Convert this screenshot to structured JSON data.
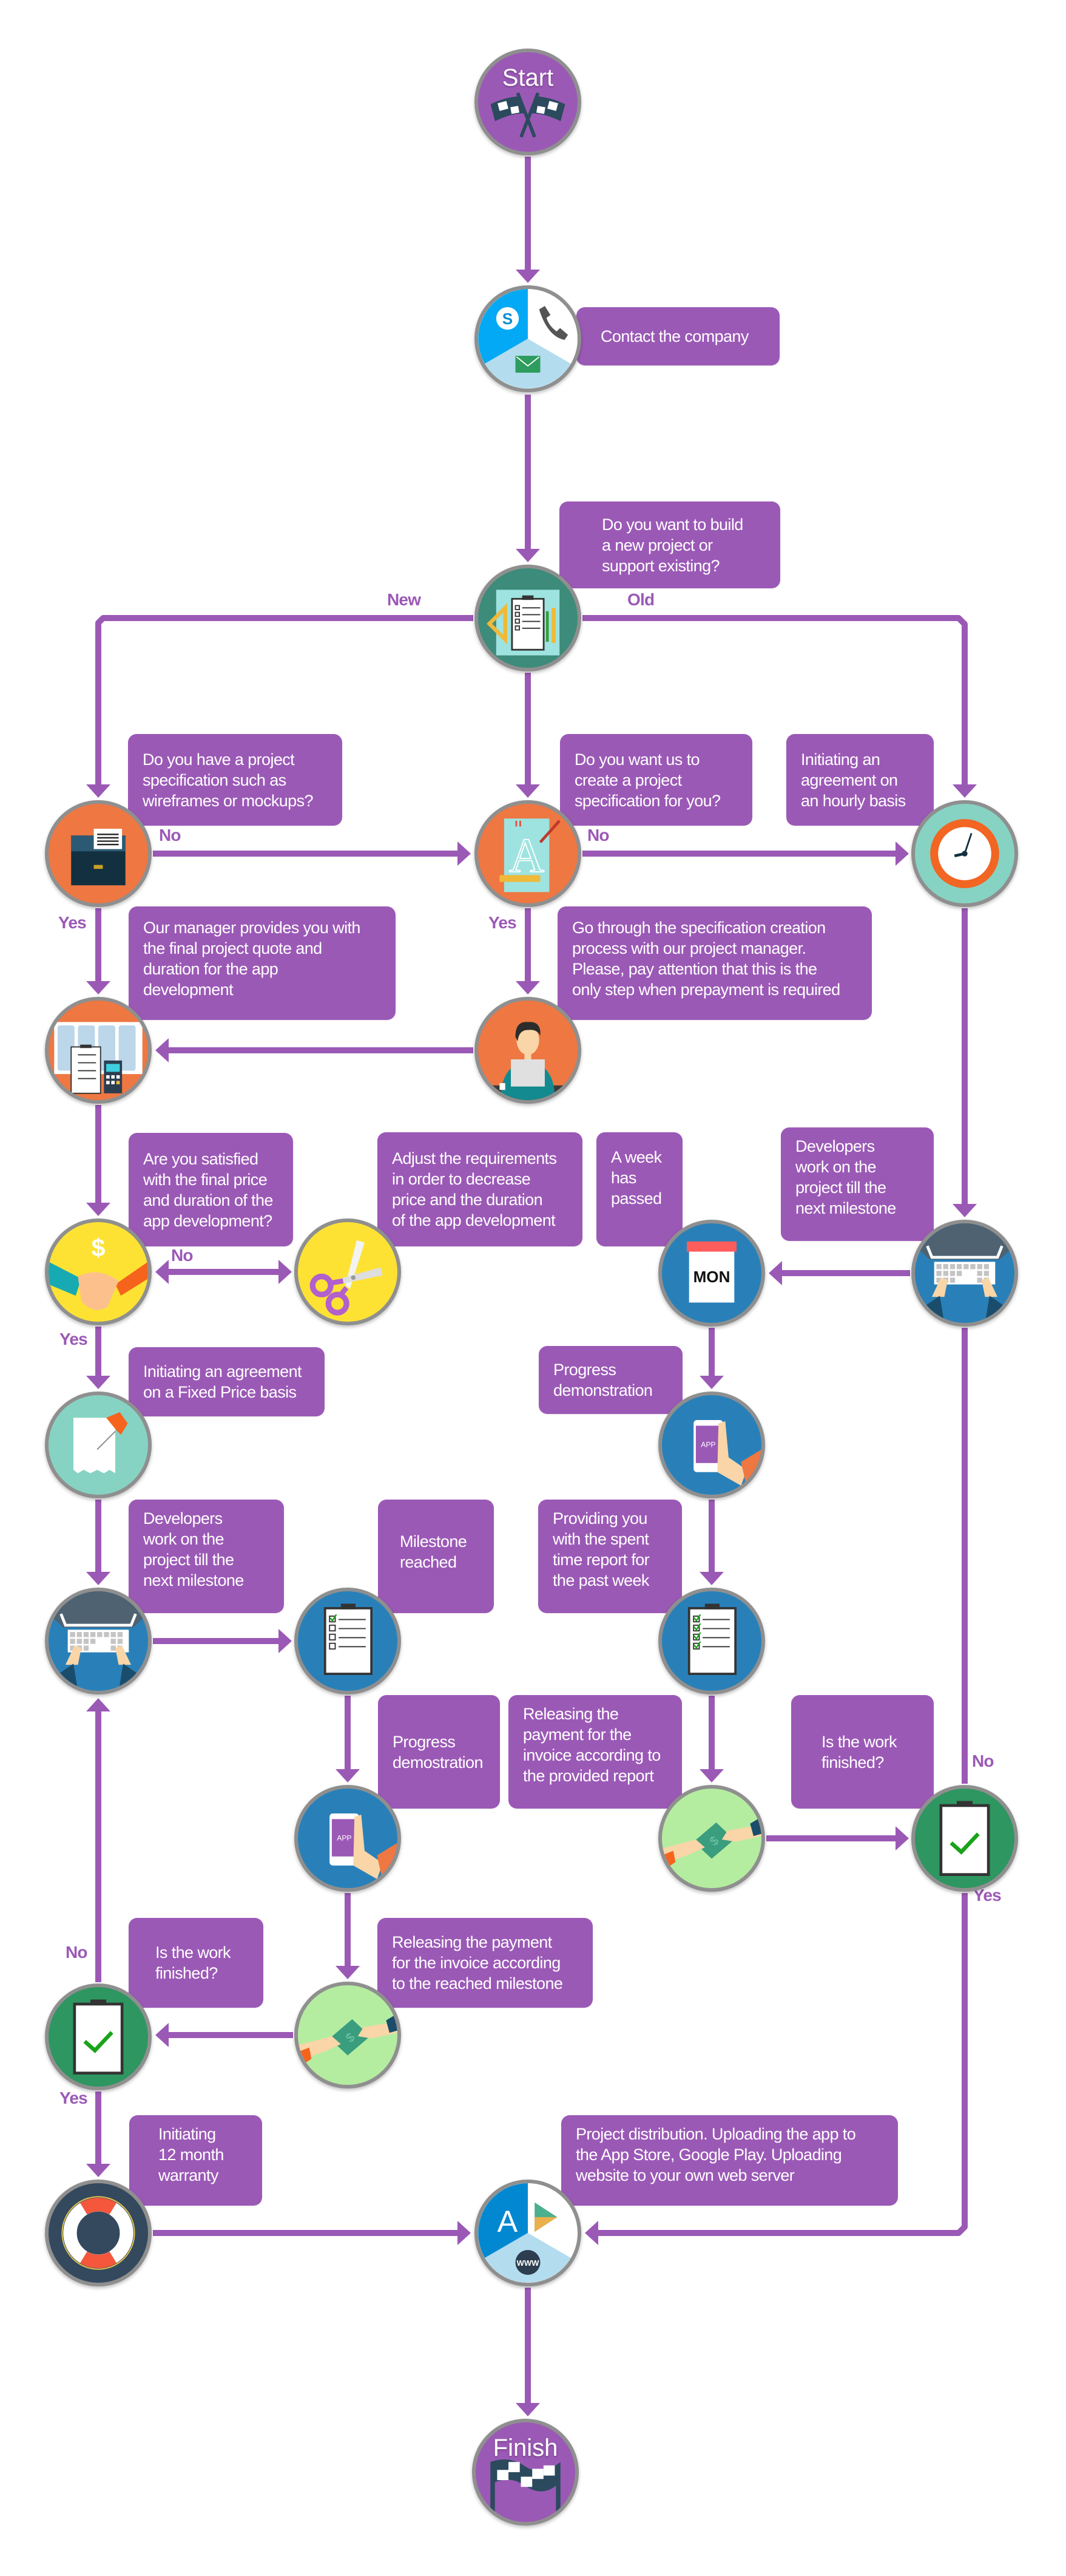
{
  "title": "App development process flowchart",
  "colors": {
    "accent": "#9b59b6",
    "node_border": "#8f8f8f",
    "orange": "#ee7742",
    "teal": "#86d3c3",
    "blue": "#2980b9",
    "yellow": "#fde234",
    "green": "#2e9660",
    "light_green": "#b4eda0",
    "navy": "#34495e"
  },
  "nodes": {
    "start": {
      "label": "Start",
      "icon": "checkered-flags-icon"
    },
    "contact": {
      "icon": "skype-phone-mail-icon",
      "text": "Contact the company"
    },
    "decision": {
      "icon": "clipboard-ruler-icon",
      "text": "Do you want to build\na new project or\nsupport existing?"
    },
    "spec_have": {
      "icon": "file-cabinet-icon",
      "text": "Do you have a project\nspecification such as\nwireframes or mockups?"
    },
    "spec_create": {
      "icon": "blueprint-pencil-icon",
      "text": "Do you want us to\ncreate a project\nspecification  for you?"
    },
    "hourly": {
      "icon": "clock-icon",
      "text": "Initiating an\nagreement on\nan hourly basis"
    },
    "quote": {
      "icon": "mockups-calculator-icon",
      "text": "Our manager provides you with\nthe final project quote and\nduration for the app\ndevelopment"
    },
    "manager": {
      "icon": "manager-laptop-icon",
      "text": "Go through the specification creation\nprocess with our project manager.\nPlease, pay attention that this is the\nonly step when prepayment is required"
    },
    "satisfied": {
      "icon": "handshake-dollar-icon",
      "text": "Are you satisfied\nwith the final price\nand duration of the\napp development?"
    },
    "adjust": {
      "icon": "scissors-icon",
      "text": "Adjust the requirements\nin order to decrease\nprice and the duration\nof the app development"
    },
    "week": {
      "icon": "calendar-mon-icon",
      "text": "A week\nhas\npassed",
      "calendar_day": "MON"
    },
    "dev_hourly": {
      "icon": "keyboard-hands-icon",
      "text": "Developers\nwork on the\nproject till the\nnext milestone"
    },
    "fixed": {
      "icon": "receipt-pin-icon",
      "text": "Initiating an agreement\non a Fixed Price basis"
    },
    "demo_hourly": {
      "icon": "phone-app-icon",
      "text": "Progress\ndemonstration",
      "app_label": "APP"
    },
    "dev_fixed": {
      "icon": "keyboard-hands-icon",
      "text": "Developers\nwork on the\nproject till the\nnext milestone"
    },
    "milestone": {
      "icon": "clipboard-one-check-icon",
      "text": "Milestone\nreached"
    },
    "report": {
      "icon": "clipboard-all-checked-icon",
      "text": "Providing you\nwith the spent\ntime report for\nthe past week"
    },
    "demo_fixed": {
      "icon": "phone-app-icon",
      "text": "Progress\ndemostration",
      "app_label": "APP"
    },
    "pay_report": {
      "icon": "money-exchange-icon",
      "text": "Releasing the\npayment for the\ninvoice according to\nthe provided report"
    },
    "finished_hourly": {
      "icon": "clipboard-check-icon",
      "text": "Is the work\nfinished?"
    },
    "pay_milestone": {
      "icon": "money-exchange-icon",
      "text": "Releasing the payment\nfor the invoice according\nto the reached milestone"
    },
    "finished_fixed": {
      "icon": "clipboard-check-icon",
      "text": "Is the work\nfinished?"
    },
    "warranty": {
      "icon": "lifebuoy-icon",
      "text": "Initiating\n12 month\nwarranty"
    },
    "distribution": {
      "icon": "appstore-playstore-www-icon",
      "text": "Project distribution. Uploading the app to\nthe App Store, Google Play. Uploading\nwebsite to your own web server"
    },
    "finish": {
      "label": "Finish",
      "icon": "checkered-flag-icon"
    }
  },
  "edge_labels": {
    "new": "New",
    "old": "Old",
    "spec_have_no": "No",
    "spec_have_yes": "Yes",
    "spec_create_no": "No",
    "spec_create_yes": "Yes",
    "satisfied_no": "No",
    "satisfied_yes": "Yes",
    "finished_hourly_no": "No",
    "finished_hourly_yes": "Yes",
    "finished_fixed_no": "No",
    "finished_fixed_yes": "Yes"
  }
}
